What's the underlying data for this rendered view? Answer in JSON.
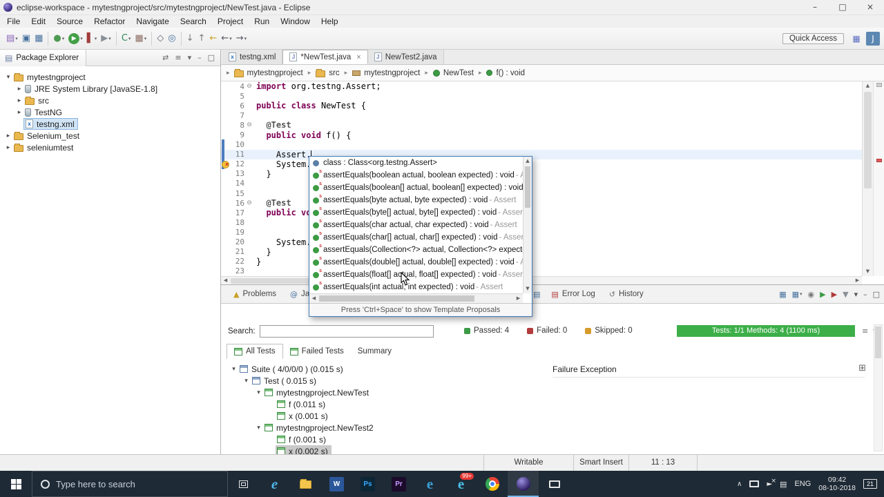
{
  "titlebar": {
    "title": "eclipse-workspace - mytestngproject/src/mytestngproject/NewTest.java - Eclipse",
    "controls": [
      {
        "name": "minimize-button",
        "glyph": "–"
      },
      {
        "name": "maximize-button",
        "glyph": "□"
      },
      {
        "name": "close-button",
        "glyph": "×"
      }
    ]
  },
  "menubar": {
    "items": [
      "File",
      "Edit",
      "Source",
      "Refactor",
      "Navigate",
      "Search",
      "Project",
      "Run",
      "Window",
      "Help"
    ]
  },
  "toolbar": {
    "quick_access_label": "Quick Access",
    "left_icons": [
      {
        "name": "new-wizard-icon",
        "glyph": "▤",
        "color": "#8a63b8",
        "dropdown": true
      },
      {
        "name": "save-icon",
        "glyph": "▣",
        "color": "#46719f"
      },
      {
        "name": "save-all-icon",
        "glyph": "▦",
        "color": "#46719f"
      },
      {
        "sep": true
      },
      {
        "name": "debug-icon",
        "glyph": "●",
        "color": "#4e9a51",
        "dropdown": true
      },
      {
        "name": "run-icon",
        "glyph": "▶",
        "color": "#ffffff",
        "bg": "#43a047",
        "dropdown": true
      },
      {
        "name": "coverage-icon",
        "glyph": "▌",
        "color": "#a23b3b",
        "dropdown": true
      },
      {
        "name": "external-tools-icon",
        "glyph": "▶",
        "color": "#8a8f98",
        "dropdown": true
      },
      {
        "sep": true
      },
      {
        "name": "new-java-class-icon",
        "glyph": "C",
        "color": "#2e8b57",
        "dropdown": true
      },
      {
        "name": "new-java-package-icon",
        "glyph": "▦",
        "color": "#8d6e63",
        "dropdown": true
      },
      {
        "sep": true
      },
      {
        "name": "open-type-icon",
        "glyph": "◇",
        "color": "#666677"
      },
      {
        "name": "search-icon",
        "glyph": "◎",
        "color": "#46719f"
      },
      {
        "sep": true
      },
      {
        "name": "next-annotation-icon",
        "glyph": "↓",
        "color": "#777777"
      },
      {
        "name": "previous-annotation-icon",
        "glyph": "↑",
        "color": "#777777"
      },
      {
        "name": "last-edit-location-icon",
        "glyph": "←",
        "color": "#c9a227"
      },
      {
        "name": "back-icon",
        "glyph": "←",
        "color": "#555566",
        "dropdown": true
      },
      {
        "name": "forward-icon",
        "glyph": "→",
        "color": "#555566",
        "dropdown": true
      }
    ],
    "right_icons": [
      {
        "name": "open-perspective-icon",
        "glyph": "▦",
        "color": "#5e6fc0"
      },
      {
        "name": "java-perspective-icon",
        "glyph": "J",
        "color": "#ffffff",
        "bg": "#5c87b2"
      }
    ]
  },
  "package_explorer": {
    "title": "Package Explorer",
    "icon_glyph": "▤",
    "header_icons": [
      {
        "name": "link-with-editor-icon",
        "glyph": "⇄"
      },
      {
        "name": "collapse-all-icon",
        "glyph": "≡"
      },
      {
        "name": "view-menu-icon",
        "glyph": "▾"
      },
      {
        "name": "minimize-icon",
        "glyph": "–"
      },
      {
        "name": "maximize-icon",
        "glyph": "□"
      }
    ],
    "tree": [
      {
        "level": 0,
        "chevron": "▾",
        "icon": "project",
        "label": "mytestngproject"
      },
      {
        "level": 1,
        "chevron": "▸",
        "icon": "library",
        "label": "JRE System Library [JavaSE-1.8]"
      },
      {
        "level": 1,
        "chevron": "▸",
        "icon": "srcfolder",
        "label": "src"
      },
      {
        "level": 1,
        "chevron": "▸",
        "icon": "library",
        "label": "TestNG"
      },
      {
        "level": 1,
        "chevron": "",
        "icon": "xmlfile",
        "label": "testng.xml",
        "selected": true
      },
      {
        "level": 0,
        "chevron": "▸",
        "icon": "project",
        "label": "Selenium_test"
      },
      {
        "level": 0,
        "chevron": "▸",
        "icon": "project",
        "label": "seleniumtest"
      }
    ]
  },
  "editor": {
    "tabs": [
      {
        "label": "testng.xml",
        "file_letter": "x",
        "letter_color": "#1565c0",
        "active": false
      },
      {
        "label": "*NewTest.java",
        "file_letter": "J",
        "letter_color": "#6a7fbf",
        "active": true,
        "close_glyph": "×"
      },
      {
        "label": "NewTest2.java",
        "file_letter": "J",
        "letter_color": "#6a7fbf",
        "active": false
      }
    ],
    "breadcrumb": [
      {
        "icon": "project",
        "label": "mytestngproject"
      },
      {
        "icon": "srcfolder",
        "label": "src"
      },
      {
        "icon": "package",
        "label": "mytestngproject"
      },
      {
        "icon": "class",
        "label": "NewTest"
      },
      {
        "icon": "method",
        "label": "f() : void"
      }
    ],
    "lines": [
      {
        "num": "4",
        "fold": "⊖",
        "segs": [
          {
            "t": "import",
            "c": "k"
          },
          {
            "t": " org.testng.Assert;",
            "c": "p"
          }
        ]
      },
      {
        "num": "5",
        "segs": []
      },
      {
        "num": "6",
        "segs": [
          {
            "t": "public",
            "c": "k"
          },
          {
            "t": " ",
            "c": "p"
          },
          {
            "t": "class",
            "c": "k"
          },
          {
            "t": " NewTest {",
            "c": "p"
          }
        ]
      },
      {
        "num": "7",
        "segs": []
      },
      {
        "num": "8",
        "fold": "⊖",
        "segs": [
          {
            "t": "  ",
            "c": "p"
          },
          {
            "t": "@Test",
            "c": "a"
          }
        ]
      },
      {
        "num": "9",
        "segs": [
          {
            "t": "  ",
            "c": "p"
          },
          {
            "t": "public",
            "c": "k"
          },
          {
            "t": " ",
            "c": "p"
          },
          {
            "t": "void",
            "c": "k"
          },
          {
            "t": " f() {",
            "c": "p"
          }
        ]
      },
      {
        "num": "10",
        "segs": []
      },
      {
        "num": "11",
        "current": true,
        "caret": true,
        "segs": [
          {
            "t": "    Assert.",
            "c": "p"
          }
        ]
      },
      {
        "num": "12",
        "marker": "error-lightbulb",
        "segs": [
          {
            "t": "    System.",
            "c": "p"
          }
        ]
      },
      {
        "num": "13",
        "segs": [
          {
            "t": "  }",
            "c": "p"
          }
        ]
      },
      {
        "num": "14",
        "segs": []
      },
      {
        "num": "15",
        "segs": []
      },
      {
        "num": "16",
        "fold": "⊖",
        "segs": [
          {
            "t": "  ",
            "c": "p"
          },
          {
            "t": "@Test",
            "c": "a"
          }
        ]
      },
      {
        "num": "17",
        "segs": [
          {
            "t": "  ",
            "c": "p"
          },
          {
            "t": "public",
            "c": "k"
          },
          {
            "t": " ",
            "c": "p"
          },
          {
            "t": "void",
            "c": "k"
          }
        ]
      },
      {
        "num": "18",
        "segs": []
      },
      {
        "num": "19",
        "segs": []
      },
      {
        "num": "20",
        "segs": [
          {
            "t": "    System.",
            "c": "p"
          }
        ]
      },
      {
        "num": "21",
        "segs": [
          {
            "t": "  }",
            "c": "p"
          }
        ]
      },
      {
        "num": "22",
        "segs": [
          {
            "t": "}",
            "c": "p"
          }
        ]
      },
      {
        "num": "23",
        "segs": []
      }
    ]
  },
  "autocomplete": {
    "items": [
      {
        "icon": "class",
        "label": "class : Class<org.testng.Assert>",
        "dim": ""
      },
      {
        "icon": "method",
        "label": "assertEquals(boolean actual, boolean expected) : void",
        "dim": " - As"
      },
      {
        "icon": "method",
        "label": "assertEquals(boolean[] actual, boolean[] expected) : void",
        "dim": " -"
      },
      {
        "icon": "method",
        "label": "assertEquals(byte actual, byte expected) : void",
        "dim": " - Assert"
      },
      {
        "icon": "method",
        "label": "assertEquals(byte[] actual, byte[] expected) : void",
        "dim": " - Assert"
      },
      {
        "icon": "method",
        "label": "assertEquals(char actual, char expected) : void",
        "dim": " - Assert"
      },
      {
        "icon": "method",
        "label": "assertEquals(char[] actual, char[] expected) : void",
        "dim": " - Assert"
      },
      {
        "icon": "method",
        "label": "assertEquals(Collection<?> actual, Collection<?> expected",
        "dim": ""
      },
      {
        "icon": "method",
        "label": "assertEquals(double[] actual, double[] expected) : void",
        "dim": " - As"
      },
      {
        "icon": "method",
        "label": "assertEquals(float[] actual, float[] expected) : void",
        "dim": " - Assert"
      },
      {
        "icon": "method",
        "label": "assertEquals(int actual, int expected) : void",
        "dim": " - Assert"
      }
    ],
    "footer": "Press 'Ctrl+Space' to show Template Proposals"
  },
  "bottom_panel": {
    "tabs_left": [
      {
        "label": "Problems",
        "icon_glyph": "▲",
        "icon_color": "#c9a227"
      },
      {
        "label": "Javadoc",
        "icon_glyph": "@",
        "icon_color": "#46719f"
      }
    ],
    "stub_icon": {
      "name": "console-icon",
      "glyph": "▤",
      "color": "#46719f"
    },
    "tabs_right": [
      {
        "label": "Error Log",
        "icon_glyph": "▤",
        "icon_color": "#b23b3b"
      },
      {
        "label": "History",
        "icon_glyph": "↺",
        "icon_color": "#777777"
      }
    ],
    "toolbar_icons": [
      {
        "name": "display-console-icon",
        "glyph": "▦",
        "color": "#46719f"
      },
      {
        "name": "open-console-icon",
        "glyph": "▦",
        "color": "#46719f",
        "dropdown": true
      },
      {
        "name": "pin-console-icon",
        "glyph": "◉",
        "color": "#777777"
      },
      {
        "name": "rerun-test-icon",
        "glyph": "▶",
        "color": "#3c9b46"
      },
      {
        "name": "rerun-failed-tests-icon",
        "glyph": "▶",
        "color": "#b23b3b"
      },
      {
        "name": "filter-icon",
        "glyph": "▼",
        "color": "#8a8f98"
      },
      {
        "name": "view-menu-icon",
        "glyph": "▾",
        "color": "#555555"
      },
      {
        "name": "minimize-icon",
        "glyph": "–",
        "color": "#555555"
      },
      {
        "name": "maximize-icon",
        "glyph": "□",
        "color": "#555555"
      }
    ],
    "search_label": "Search:",
    "search_value": "",
    "counts": [
      {
        "name": "passed",
        "label": "Passed: 4",
        "color": "#3c9b46"
      },
      {
        "name": "failed",
        "label": "Failed: 0",
        "color": "#b23b3b"
      },
      {
        "name": "skipped",
        "label": "Skipped: 0",
        "color": "#d69b2a"
      }
    ],
    "progress_text": "Tests: 1/1  Methods: 4 (1100 ms)",
    "progress_color": "#3daf49",
    "side_icons": [
      {
        "name": "results-menu-icon",
        "glyph": "≡"
      },
      {
        "name": "results-dropdown-icon",
        "glyph": "▾"
      }
    ],
    "view_tabs": [
      {
        "label": "All Tests",
        "active": true,
        "icon": "green-table"
      },
      {
        "label": "Failed Tests",
        "active": false,
        "icon": "green-table"
      },
      {
        "label": "Summary",
        "active": false,
        "icon": ""
      }
    ],
    "test_tree": [
      {
        "level": 0,
        "chevron": "▾",
        "icon": "blue-table",
        "label": "Suite ( 4/0/0/0 ) (0.015 s)"
      },
      {
        "level": 1,
        "chevron": "▾",
        "icon": "blue-table",
        "label": "Test ( 0.015 s)"
      },
      {
        "level": 2,
        "chevron": "▾",
        "icon": "green-table",
        "label": "mytestngproject.NewTest"
      },
      {
        "level": 3,
        "chevron": "",
        "icon": "green-table",
        "label": "f (0.011 s)"
      },
      {
        "level": 3,
        "chevron": "",
        "icon": "green-table",
        "label": "x (0.001 s)"
      },
      {
        "level": 2,
        "chevron": "▾",
        "icon": "green-table",
        "label": "mytestngproject.NewTest2"
      },
      {
        "level": 3,
        "chevron": "",
        "icon": "green-table",
        "label": "f (0.001 s)"
      },
      {
        "level": 3,
        "chevron": "",
        "icon": "green-table",
        "label": "x (0.002 s)",
        "selected": true
      }
    ],
    "failure_panel_title": "Failure Exception",
    "failure_grid_glyph": "⊞"
  },
  "statusbar": {
    "writable": "Writable",
    "insert_mode": "Smart Insert",
    "caret_position": "11 : 13"
  },
  "taskbar": {
    "search_text": "Type here to search",
    "apps": [
      {
        "name": "task-view-icon",
        "type": "taskview"
      },
      {
        "name": "edge-icon",
        "type": "letter",
        "glyph": "e",
        "color": "#4fb6e8",
        "italic": true
      },
      {
        "name": "file-explorer-icon",
        "type": "folder"
      },
      {
        "name": "word-icon",
        "type": "tile",
        "glyph": "W",
        "bg": "#2b579a",
        "fg": "#ffffff"
      },
      {
        "name": "photoshop-icon",
        "type": "tile",
        "glyph": "Ps",
        "bg": "#0d2636",
        "fg": "#34a8ff"
      },
      {
        "name": "premiere-icon",
        "type": "tile",
        "glyph": "Pr",
        "bg": "#1c0b2b",
        "fg": "#c79bff"
      },
      {
        "name": "internet-explorer-icon",
        "type": "letter",
        "glyph": "e",
        "color": "#3aa0d8"
      },
      {
        "name": "browser-badge-icon",
        "type": "letter",
        "glyph": "e",
        "color": "#49c1e8",
        "badge": "99+"
      },
      {
        "name": "chrome-icon",
        "type": "chrome"
      },
      {
        "name": "eclipse-icon",
        "type": "eclipse",
        "active": true
      },
      {
        "name": "display-icon",
        "type": "monitor"
      }
    ],
    "tray": {
      "chevron": "∧",
      "network_glyph": "▤",
      "lang": "ENG",
      "time": "09:42",
      "date": "08-10-2018",
      "notification_count": "21"
    }
  }
}
